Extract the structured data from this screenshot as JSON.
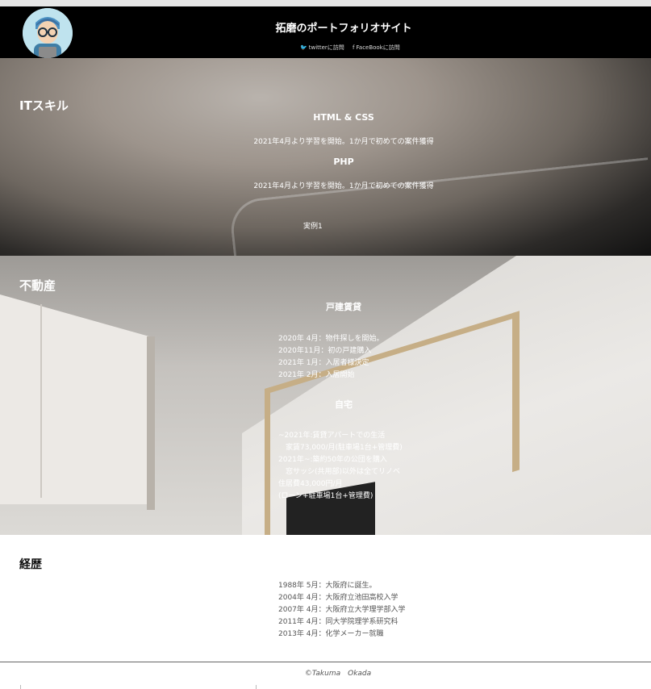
{
  "header": {
    "site_title": "拓磨のポートフォリオサイト",
    "twitter_label": "twitterに訪問",
    "facebook_label": "FaceBookに訪問"
  },
  "it_section": {
    "title": "ITスキル",
    "html_css": {
      "heading": "HTML & CSS",
      "desc": "2021年4月より学習を開始。1か月で初めての案件獲得"
    },
    "php": {
      "heading": "PHP",
      "desc": "2021年4月より学習を開始。1か月で初めての案件獲得"
    },
    "example_link": "実例1"
  },
  "realestate_section": {
    "title": "不動産",
    "detached": {
      "heading": "戸建賃貸",
      "lines": [
        "2020年 4月：物件探しを開始。",
        "2020年11月：初の戸建購入",
        "2021年 1月：入居者様決定",
        "2021年 2月：入居開始"
      ]
    },
    "home": {
      "heading": "自宅",
      "lines": [
        "~2021年:賃貸アパートでの生活",
        "　家賃73,000/月(駐車場1台+管理費)",
        "2021年~:築約50年の公団を購入",
        "　窓サッシ(共用部)以外は全てリノベ",
        "住居費43,000円/月",
        "(ローン+駐車場1台+管理費)"
      ]
    }
  },
  "history_section": {
    "title": "経歴",
    "lines": [
      "1988年 5月：大阪府に誕生。",
      "2004年 4月：大阪府立池田高校入学",
      "2007年 4月：大阪府立大学理学部入学",
      "2011年 4月：同大学院理学系研究科",
      "2013年 4月：化学メーカー就職"
    ]
  },
  "footer": {
    "copyright": "©Takuma　Okada"
  },
  "colors": {
    "header_bg": "#000000",
    "text_light": "#ffffff",
    "history_text": "#555555"
  },
  "icons": {
    "twitter": "twitter-icon",
    "facebook": "facebook-icon",
    "avatar": "avatar-illustration"
  }
}
